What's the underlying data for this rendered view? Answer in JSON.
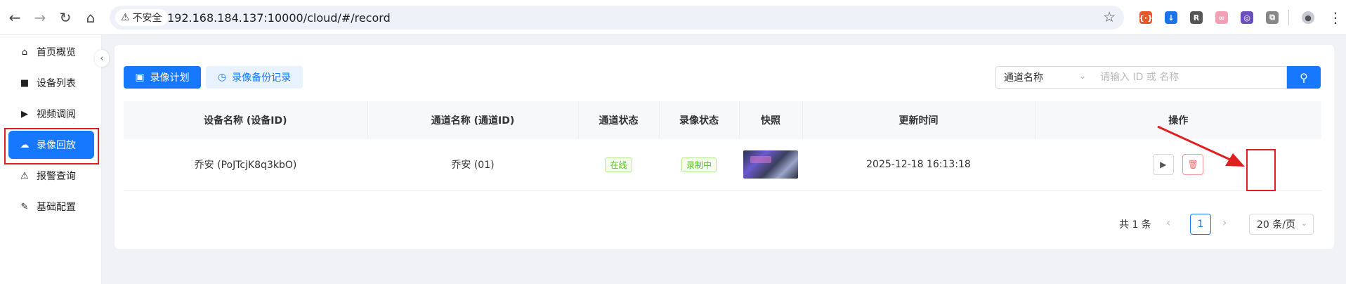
{
  "browser": {
    "security_label": "不安全",
    "url": "192.168.184.137:10000/cloud/#/record",
    "back_icon": "←",
    "forward_icon": "→",
    "reload_icon": "↻",
    "home_icon": "⌂",
    "star_icon": "☆",
    "menu_icon": "⋮",
    "extensions": [
      {
        "name": "ext-red",
        "glyph": "{·}",
        "color": "#e8572a"
      },
      {
        "name": "ext-blue",
        "glyph": "↓",
        "color": "#1a73e8"
      },
      {
        "name": "ext-r",
        "glyph": "R",
        "color": "#555555"
      },
      {
        "name": "ext-pink",
        "glyph": "∞",
        "color": "#f3a0b5"
      },
      {
        "name": "ext-purple",
        "glyph": "◎",
        "color": "#6b4fbb"
      },
      {
        "name": "ext-puzzle",
        "glyph": "⧉",
        "color": "#888888"
      }
    ]
  },
  "sidebar": {
    "collapse_icon": "‹",
    "items": [
      {
        "label": "首页概览",
        "icon": "⌂",
        "icon_name": "home-icon"
      },
      {
        "label": "设备列表",
        "icon": "■",
        "icon_name": "camera-icon"
      },
      {
        "label": "视频调阅",
        "icon": "▶",
        "icon_name": "play-icon"
      },
      {
        "label": "录像回放",
        "icon": "☁",
        "icon_name": "cloud-icon",
        "active": true
      },
      {
        "label": "报警查询",
        "icon": "⚠",
        "icon_name": "alarm-icon"
      },
      {
        "label": "基础配置",
        "icon": "✎",
        "icon_name": "edit-icon"
      }
    ]
  },
  "toolbar": {
    "record_plan_label": "录像计划",
    "backup_label": "录像备份记录",
    "select_value": "通道名称",
    "search_placeholder": "请输入 ID 或 名称",
    "search_icon": "⚲"
  },
  "table": {
    "columns": [
      "设备名称 (设备ID)",
      "通道名称 (通道ID)",
      "通道状态",
      "录像状态",
      "快照",
      "更新时间",
      "操作"
    ],
    "rows": [
      {
        "device": "乔安 (PoJTcjK8q3kbO)",
        "channel": "乔安 (01)",
        "channel_status": "在线",
        "record_status": "录制中",
        "updated": "2025-12-18 16:13:18",
        "play_icon": "▶",
        "delete_icon": "🗑"
      }
    ]
  },
  "pagination": {
    "total_text": "共 1 条",
    "prev_icon": "‹",
    "current_page": "1",
    "next_icon": "›",
    "page_size": "20 条/页"
  },
  "colors": {
    "primary": "#1677ff",
    "highlight": "#e02020",
    "status_green": "#52c41a"
  }
}
